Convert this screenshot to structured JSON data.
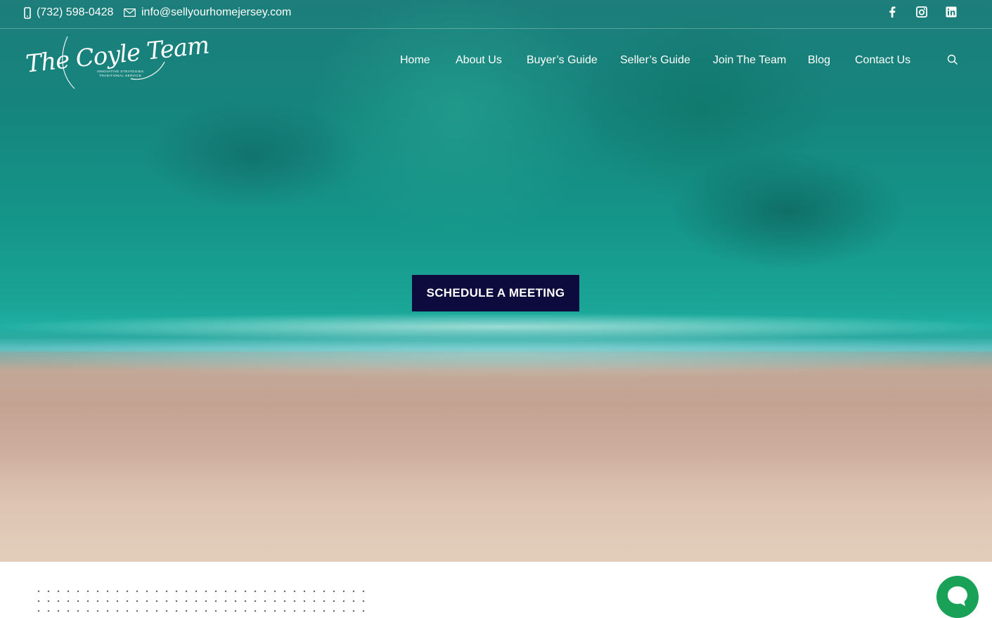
{
  "topbar": {
    "phone": "(732) 598-0428",
    "email": "info@sellyourhomejersey.com",
    "phone_icon": "mobile-phone-icon",
    "email_icon": "envelope-icon",
    "social": [
      {
        "name": "facebook-icon",
        "glyph": "f"
      },
      {
        "name": "instagram-icon",
        "glyph": ""
      },
      {
        "name": "linkedin-icon",
        "glyph": "in"
      }
    ]
  },
  "logo": {
    "text": "The Coyle Team",
    "tagline_1": "INNOVATIVE STRATEGIES",
    "tagline_2": "TRADITIONAL SERVICE"
  },
  "nav": {
    "items": [
      "Home",
      "About Us",
      "Buyer’s Guide",
      "Seller’s Guide",
      "Join The Team",
      "Blog",
      "Contact Us"
    ],
    "search_icon": "search-icon"
  },
  "hero": {
    "cta_label": "SCHEDULE A MEETING"
  },
  "chat": {
    "icon": "chat-bubble-icon"
  },
  "colors": {
    "cta_bg": "#0d0b3d",
    "chat_bg": "#1aa158",
    "ocean": "#15968a",
    "sand": "#dec5b4"
  }
}
